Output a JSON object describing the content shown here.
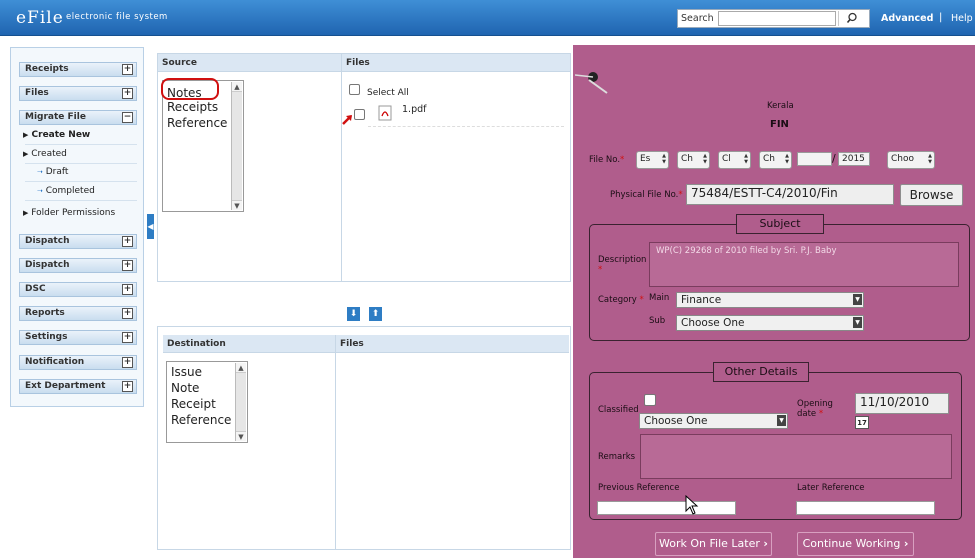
{
  "header": {
    "logo": "eFile",
    "subtitle": "electronic file system",
    "search_label": "Search",
    "advanced": "Advanced",
    "separator": "|",
    "help": "Help"
  },
  "sidebar": {
    "receipts": "Receipts",
    "files": "Files",
    "migrate_file": "Migrate File",
    "create_new": "Create New",
    "created": "Created",
    "draft": "Draft",
    "completed": "Completed",
    "folder_permissions": "Folder Permissions",
    "dispatch1": "Dispatch",
    "dispatch2": "Dispatch",
    "dsc": "DSC",
    "reports": "Reports",
    "settings": "Settings",
    "notification": "Notification",
    "ext_department": "Ext Department"
  },
  "source": {
    "header": "Source",
    "items": [
      "Notes",
      "Receipts",
      "Reference"
    ],
    "files_header": "Files",
    "select_all": "Select All",
    "file_name": "1.pdf"
  },
  "destination": {
    "header": "Destination",
    "items": [
      "Issue",
      "Note",
      "Receipt",
      "Reference"
    ],
    "files_header": "Files"
  },
  "form": {
    "state": "Kerala",
    "dept": "FIN",
    "file_no_label": "File No.",
    "file_no_parts": [
      "Es",
      "Ch",
      "Cl",
      "Ch"
    ],
    "file_no_slash": "/",
    "file_no_year": "2015",
    "file_no_choose": "Choo",
    "physical_label": "Physical File No.",
    "physical_value": "75484/ESTT-C4/2010/Fin",
    "browse": "Browse",
    "subject_legend": "Subject",
    "description_label": "Description",
    "description_value": "WP(C) 29268  of 2010  filed by Sri. P.J. Baby",
    "category_label": "Category",
    "main_label": "Main",
    "main_value": "Finance",
    "sub_label": "Sub",
    "sub_value": "Choose One",
    "other_legend": "Other Details",
    "classified_label": "Classified",
    "classified_value": "Choose One",
    "opening_label": "Opening date",
    "opening_value": "11/10/2010",
    "calendar_day": "17",
    "remarks_label": "Remarks",
    "prev_ref_label": "Previous Reference",
    "later_ref_label": "Later Reference",
    "work_later": "Work On File Later",
    "continue": "Continue Working",
    "btn_arrow": "›"
  },
  "colors": {
    "header_blue": "#2a76c6",
    "form_bg": "#b05d8c",
    "highlight_red": "#d01010"
  }
}
